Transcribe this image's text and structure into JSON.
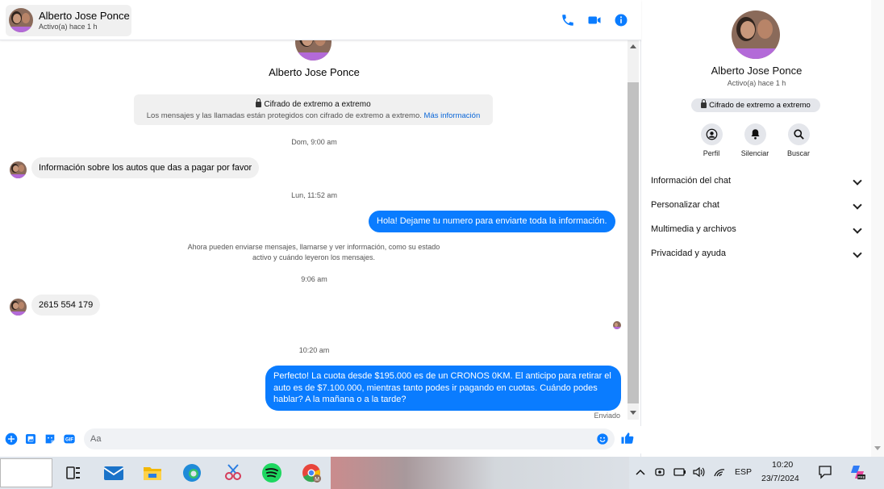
{
  "header": {
    "contact_name": "Alberto Jose Ponce",
    "status": "Activo(a) hace 1 h"
  },
  "conversation": {
    "contact_name": "Alberto Jose Ponce",
    "e2e_title": "Cifrado de extremo a extremo",
    "e2e_text": "Los mensajes y las llamadas están protegidos con cifrado de extremo a extremo.",
    "e2e_link": "Más información",
    "timestamps": [
      "Dom, 9:00 am",
      "Lun, 11:52 am",
      "9:06 am",
      "10:20 am"
    ],
    "messages": [
      {
        "from": "contact",
        "text": "Información sobre los autos que das a pagar por favor"
      },
      {
        "from": "me",
        "text": "Hola! Dejame tu numero  para enviarte toda la información."
      },
      {
        "from": "contact",
        "text": "2615 554 179"
      },
      {
        "from": "me",
        "text": "Perfecto! La cuota desde $195.000 es de un CRONOS 0KM. El anticipo para retirar el auto es de $7.100.000, mientras tanto podes ir pagando en cuotas. Cuándo podes hablar? A la mañana o a la tarde?"
      }
    ],
    "notice": "Ahora pueden enviarse mensajes, llamarse y ver información, como su estado activo y cuándo leyeron los mensajes.",
    "sent_label": "Enviado"
  },
  "composer": {
    "placeholder": "Aa"
  },
  "info_panel": {
    "name": "Alberto Jose Ponce",
    "status": "Activo(a) hace 1 h",
    "e2e_badge": "Cifrado de extremo a extremo",
    "actions": [
      "Perfil",
      "Silenciar",
      "Buscar"
    ],
    "sections": [
      "Información del chat",
      "Personalizar chat",
      "Multimedia y archivos",
      "Privacidad y ayuda"
    ]
  },
  "taskbar": {
    "language": "ESP",
    "time": "10:20",
    "date": "23/7/2024",
    "apps": [
      "task-view-icon",
      "mail-icon",
      "file-explorer-icon",
      "edge-icon",
      "snipping-icon",
      "spotify-icon",
      "chrome-icon"
    ]
  },
  "colors": {
    "accent": "#0a7cff",
    "bubble_in": "#f0f0f0",
    "avatar_band": "#b36ad8"
  }
}
